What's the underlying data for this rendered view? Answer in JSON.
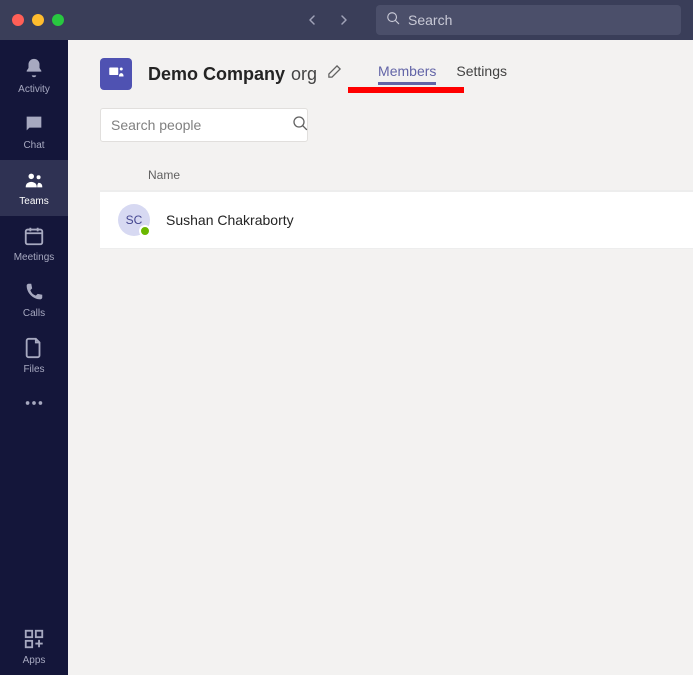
{
  "titlebar": {
    "search_placeholder": "Search"
  },
  "rail": {
    "items": [
      {
        "label": "Activity"
      },
      {
        "label": "Chat"
      },
      {
        "label": "Teams"
      },
      {
        "label": "Meetings"
      },
      {
        "label": "Calls"
      },
      {
        "label": "Files"
      }
    ],
    "apps_label": "Apps"
  },
  "header": {
    "org_name": "Demo Company",
    "org_suffix": "org"
  },
  "tabs": {
    "members": "Members",
    "settings": "Settings"
  },
  "search_people": {
    "placeholder": "Search people"
  },
  "table": {
    "name_header": "Name"
  },
  "members": [
    {
      "initials": "SC",
      "name": "Sushan Chakraborty"
    }
  ]
}
